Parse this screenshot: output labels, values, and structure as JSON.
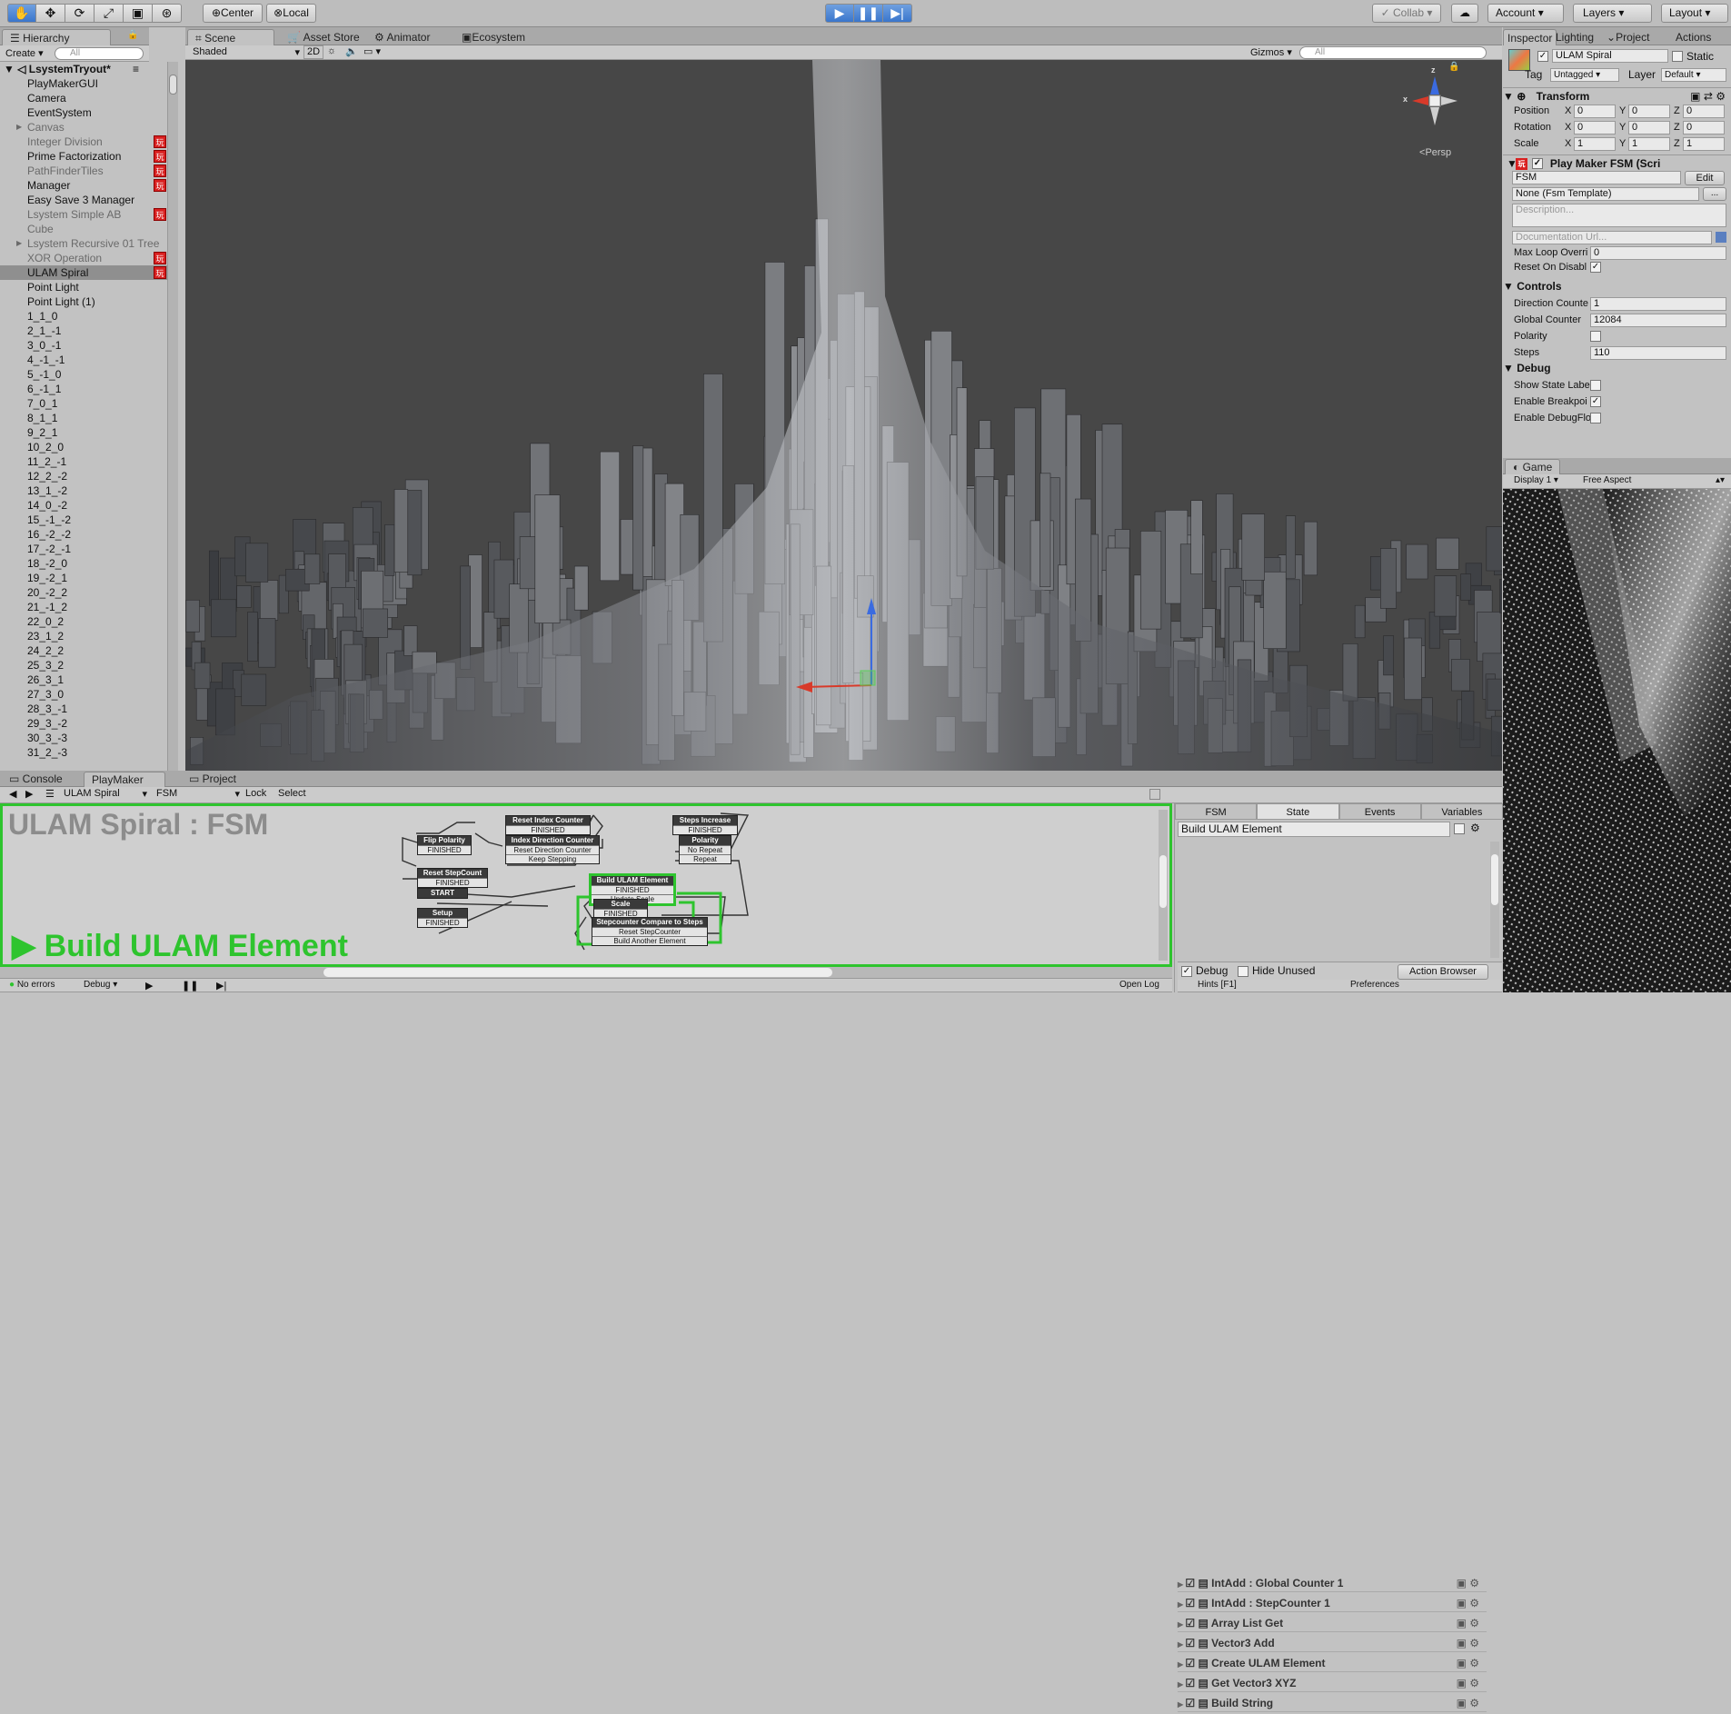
{
  "toolbar": {
    "tools": [
      "hand-tool",
      "move-tool",
      "rotate-tool",
      "scale-tool",
      "rect-tool",
      "transform-tool"
    ],
    "pivot": "Center",
    "space": "Local",
    "collab": "Collab",
    "account": "Account",
    "layers": "Layers",
    "layout": "Layout"
  },
  "hierarchy": {
    "tab": "Hierarchy",
    "create": "Create",
    "search_placeholder": "All",
    "scene": "LsystemTryout*",
    "items": [
      {
        "label": "PlayMakerGUI",
        "dim": false,
        "badge": false
      },
      {
        "label": "Camera",
        "dim": false,
        "badge": false
      },
      {
        "label": "EventSystem",
        "dim": false,
        "badge": false
      },
      {
        "label": "Canvas",
        "dim": true,
        "badge": false
      },
      {
        "label": "Integer Division",
        "dim": true,
        "badge": true
      },
      {
        "label": "Prime Factorization",
        "dim": false,
        "badge": true
      },
      {
        "label": "PathFinderTiles",
        "dim": true,
        "badge": true
      },
      {
        "label": "Manager",
        "dim": false,
        "badge": true
      },
      {
        "label": "Easy Save 3 Manager",
        "dim": false,
        "badge": false
      },
      {
        "label": "Lsystem Simple AB",
        "dim": true,
        "badge": true
      },
      {
        "label": "Cube",
        "dim": true,
        "badge": false
      },
      {
        "label": "Lsystem Recursive 01 Tree",
        "dim": true,
        "badge": false
      },
      {
        "label": "XOR Operation",
        "dim": true,
        "badge": true
      },
      {
        "label": "ULAM Spiral",
        "dim": false,
        "badge": true
      },
      {
        "label": "Point Light",
        "dim": false,
        "badge": false
      },
      {
        "label": "Point Light (1)",
        "dim": false,
        "badge": false
      },
      {
        "label": "1_1_0",
        "dim": false,
        "badge": false
      },
      {
        "label": "2_1_-1",
        "dim": false,
        "badge": false
      },
      {
        "label": "3_0_-1",
        "dim": false,
        "badge": false
      },
      {
        "label": "4_-1_-1",
        "dim": false,
        "badge": false
      },
      {
        "label": "5_-1_0",
        "dim": false,
        "badge": false
      },
      {
        "label": "6_-1_1",
        "dim": false,
        "badge": false
      },
      {
        "label": "7_0_1",
        "dim": false,
        "badge": false
      },
      {
        "label": "8_1_1",
        "dim": false,
        "badge": false
      },
      {
        "label": "9_2_1",
        "dim": false,
        "badge": false
      },
      {
        "label": "10_2_0",
        "dim": false,
        "badge": false
      },
      {
        "label": "11_2_-1",
        "dim": false,
        "badge": false
      },
      {
        "label": "12_2_-2",
        "dim": false,
        "badge": false
      },
      {
        "label": "13_1_-2",
        "dim": false,
        "badge": false
      },
      {
        "label": "14_0_-2",
        "dim": false,
        "badge": false
      },
      {
        "label": "15_-1_-2",
        "dim": false,
        "badge": false
      },
      {
        "label": "16_-2_-2",
        "dim": false,
        "badge": false
      },
      {
        "label": "17_-2_-1",
        "dim": false,
        "badge": false
      },
      {
        "label": "18_-2_0",
        "dim": false,
        "badge": false
      },
      {
        "label": "19_-2_1",
        "dim": false,
        "badge": false
      },
      {
        "label": "20_-2_2",
        "dim": false,
        "badge": false
      },
      {
        "label": "21_-1_2",
        "dim": false,
        "badge": false
      },
      {
        "label": "22_0_2",
        "dim": false,
        "badge": false
      },
      {
        "label": "23_1_2",
        "dim": false,
        "badge": false
      },
      {
        "label": "24_2_2",
        "dim": false,
        "badge": false
      },
      {
        "label": "25_3_2",
        "dim": false,
        "badge": false
      },
      {
        "label": "26_3_1",
        "dim": false,
        "badge": false
      },
      {
        "label": "27_3_0",
        "dim": false,
        "badge": false
      },
      {
        "label": "28_3_-1",
        "dim": false,
        "badge": false
      },
      {
        "label": "29_3_-2",
        "dim": false,
        "badge": false
      },
      {
        "label": "30_3_-3",
        "dim": false,
        "badge": false
      },
      {
        "label": "31_2_-3",
        "dim": false,
        "badge": false
      }
    ]
  },
  "scene": {
    "tabs": [
      "Scene",
      "Asset Store",
      "Animator",
      "Ecosystem"
    ],
    "shading": "Shaded",
    "mode2d": "2D",
    "gizmos": "Gizmos",
    "search_placeholder": "All",
    "persp": "Persp",
    "axis_x": "x",
    "axis_z": "z"
  },
  "inspector": {
    "tabs": [
      "Inspector",
      "Lighting",
      "Project",
      "Actions"
    ],
    "object_name": "ULAM Spiral",
    "static": "Static",
    "tag_label": "Tag",
    "tag": "Untagged",
    "layer_label": "Layer",
    "layer": "Default",
    "transform": {
      "title": "Transform",
      "rows": [
        {
          "label": "Position",
          "x": "0",
          "y": "0",
          "z": "0"
        },
        {
          "label": "Rotation",
          "x": "0",
          "y": "0",
          "z": "0"
        },
        {
          "label": "Scale",
          "x": "1",
          "y": "1",
          "z": "1"
        }
      ]
    },
    "fsm": {
      "title": "Play Maker FSM (Scri",
      "name": "FSM",
      "edit": "Edit",
      "template": "None (Fsm Template)",
      "more": "...",
      "description": "Description...",
      "doc_url": "Documentation Url...",
      "max_loop_label": "Max Loop Overri",
      "max_loop": "0",
      "reset_label": "Reset On Disabl"
    },
    "controls": {
      "title": "Controls",
      "rows": [
        {
          "label": "Direction Counte",
          "value": "1"
        },
        {
          "label": "Global Counter",
          "value": "12084"
        },
        {
          "label": "Polarity",
          "value": ""
        },
        {
          "label": "Steps",
          "value": "110"
        }
      ]
    },
    "debug": {
      "title": "Debug",
      "rows": [
        {
          "label": "Show State Labe",
          "checked": false
        },
        {
          "label": "Enable Breakpoi",
          "checked": true
        },
        {
          "label": "Enable DebugFlo",
          "checked": false
        }
      ]
    }
  },
  "game": {
    "tab": "Game",
    "display": "Display 1",
    "aspect": "Free Aspect"
  },
  "playmaker": {
    "tabs": [
      "Console",
      "PlayMaker",
      "Project"
    ],
    "object": "ULAM Spiral",
    "fsm": "FSM",
    "lock": "Lock",
    "select": "Select",
    "title": "ULAM Spiral : FSM",
    "state_title": "Build ULAM Element",
    "nodes": [
      {
        "title": "Reset Index Counter",
        "rows": [
          "FINISHED"
        ]
      },
      {
        "title": "Steps Increase",
        "rows": [
          "FINISHED"
        ]
      },
      {
        "title": "Flip Polarity",
        "rows": [
          "FINISHED"
        ]
      },
      {
        "title": "Index Direction Counter",
        "rows": [
          "Reset Direction Counter",
          "Keep Stepping"
        ]
      },
      {
        "title": "Polarity",
        "rows": [
          "No Repeat",
          "Repeat"
        ]
      },
      {
        "title": "Reset StepCount",
        "rows": [
          "FINISHED"
        ]
      },
      {
        "title": "START",
        "rows": []
      },
      {
        "title": "Build ULAM Element",
        "rows": [
          "FINISHED",
          "Update Scale"
        ]
      },
      {
        "title": "Scale",
        "rows": [
          "FINISHED"
        ]
      },
      {
        "title": "Setup",
        "rows": [
          "FINISHED"
        ]
      },
      {
        "title": "Stepcounter Compare to Steps",
        "rows": [
          "Reset StepCounter",
          "Build Another Element"
        ]
      }
    ],
    "panel_tabs": [
      "FSM",
      "State",
      "Events",
      "Variables"
    ],
    "state_name": "Build ULAM Element",
    "actions": [
      "IntAdd : Global Counter 1",
      "IntAdd : StepCounter 1",
      "Array List Get",
      "Vector3 Add",
      "Create ULAM Element",
      "Get Vector3 XYZ",
      "Build String"
    ],
    "debug": "Debug",
    "hide_unused": "Hide Unused",
    "action_browser": "Action Browser",
    "hints": "Hints [F1]",
    "preferences": "Preferences",
    "status": {
      "errors": "No errors",
      "debug": "Debug",
      "open_log": "Open Log"
    }
  },
  "colors": {
    "accent_green": "#2ec42e",
    "play_blue": "#3a76cc",
    "badge_red": "#d92020"
  }
}
